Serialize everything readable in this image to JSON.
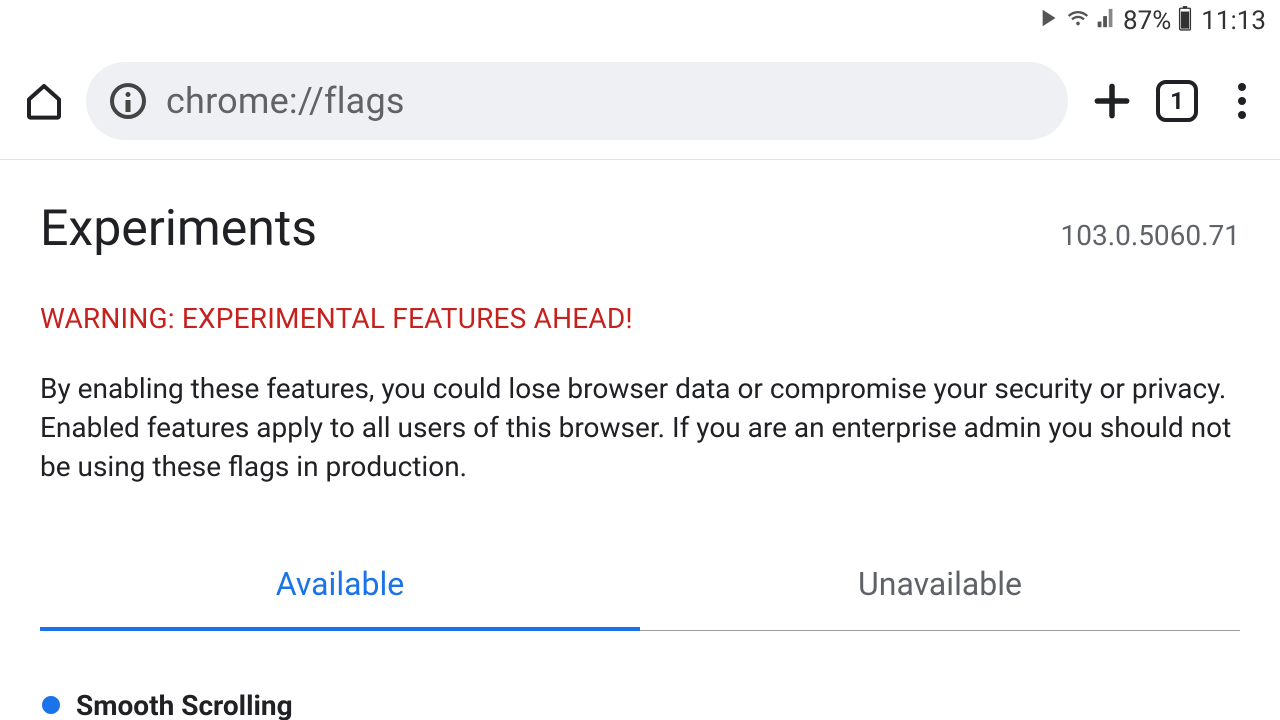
{
  "status_bar": {
    "battery_pct": "87%",
    "time": "11:13"
  },
  "toolbar": {
    "url": "chrome://flags",
    "tab_count": "1"
  },
  "page": {
    "title": "Experiments",
    "version": "103.0.5060.71",
    "warning": "WARNING: EXPERIMENTAL FEATURES AHEAD!",
    "description": "By enabling these features, you could lose browser data or compromise your security or privacy. Enabled features apply to all users of this browser. If you are an enterprise admin you should not be using these flags in production."
  },
  "tabs": {
    "available": "Available",
    "unavailable": "Unavailable"
  },
  "flags": [
    {
      "title": "Smooth Scrolling"
    }
  ]
}
